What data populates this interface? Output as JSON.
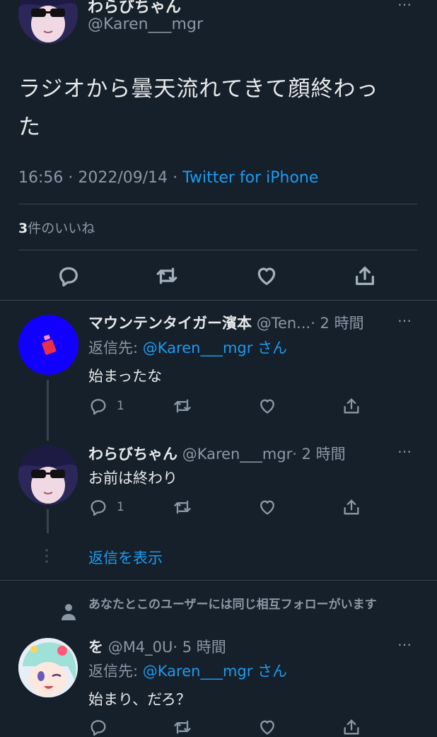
{
  "focused": {
    "display_name": "わらびちゃん",
    "handle": "@Karen___mgr",
    "text_line1": "ラジオから曇天流れてきて顔終わっ",
    "text_line2": "た",
    "time": "16:56 · 2022/09/14 · ",
    "source": "Twitter for iPhone",
    "likes_count": "3",
    "likes_label": "件のいいね"
  },
  "replies": [
    {
      "display_name": "マウンテンタイガー濱本",
      "handle": "@Ten...",
      "age": "· 2 時間",
      "reply_to_prefix": "返信先: ",
      "reply_to_handle": "@Karen___mgr",
      "reply_to_suffix": " さん",
      "text": "始まったな",
      "reply_count": "1"
    },
    {
      "display_name": "わらびちゃん",
      "handle": "@Karen___mgr",
      "age": "· 2 時間",
      "text": "お前は終わり",
      "reply_count": "1"
    },
    {
      "show_replies": "返信を表示"
    },
    {
      "context": "あなたとこのユーザーには同じ相互フォローがいます",
      "display_name": "を",
      "handle": "@M4_0U",
      "age": "· 5 時間",
      "reply_to_prefix": "返信先: ",
      "reply_to_handle": "@Karen___mgr",
      "reply_to_suffix": " さん",
      "text": "始まり、だろ？"
    }
  ],
  "more_icon": "⋯",
  "colors": {
    "bg": "#15202b",
    "link": "#1d9bf0",
    "muted": "#8b98a5",
    "divider": "#38444d"
  }
}
